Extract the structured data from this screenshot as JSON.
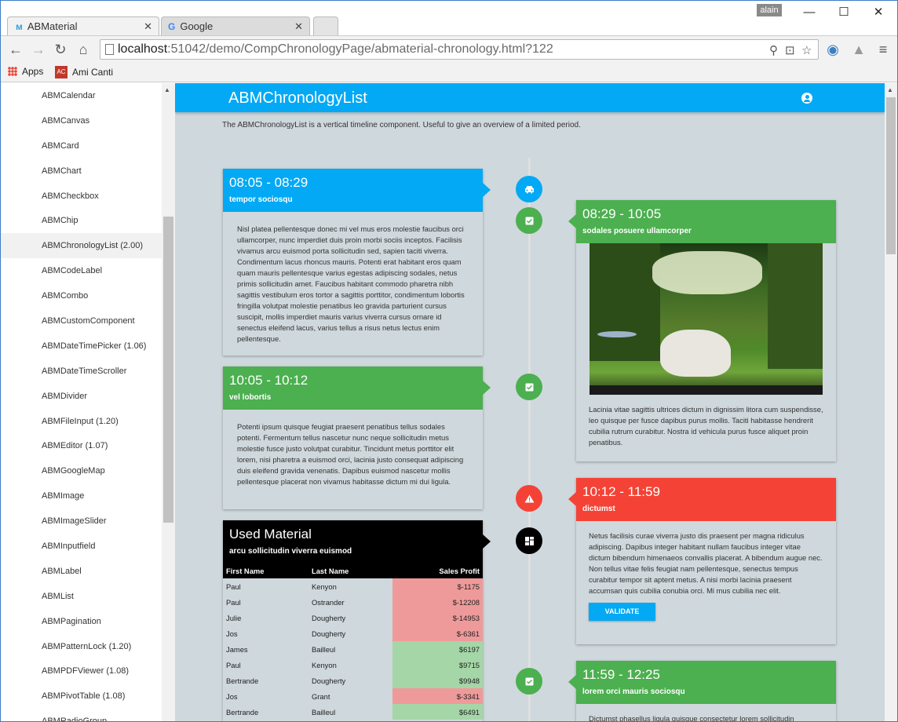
{
  "browser": {
    "tabs": [
      {
        "label": "ABMaterial",
        "icon": "abmaterial-logo-icon"
      },
      {
        "label": "Google",
        "icon": "google-g-icon"
      }
    ],
    "user": "alain",
    "address": {
      "host": "localhost",
      "path": ":51042/demo/CompChronologyPage/abmaterial-chronology.html?122"
    },
    "bookmarks": [
      {
        "label": "Apps",
        "icon": "apps-grid-icon"
      },
      {
        "label": "Ami Canti",
        "icon": "ami-canti-icon"
      }
    ]
  },
  "sidebar": {
    "items": [
      "ABMCalendar",
      "ABMCanvas",
      "ABMCard",
      "ABMChart",
      "ABMCheckbox",
      "ABMChip",
      "ABMChronologyList (2.00)",
      "ABMCodeLabel",
      "ABMCombo",
      "ABMCustomComponent",
      "ABMDateTimePicker (1.06)",
      "ABMDateTimeScroller",
      "ABMDivider",
      "ABMFileInput (1.20)",
      "ABMEditor (1.07)",
      "ABMGoogleMap",
      "ABMImage",
      "ABMImageSlider",
      "ABMInputfield",
      "ABMLabel",
      "ABMList",
      "ABMPagination",
      "ABMPatternLock (1.20)",
      "ABMPDFViewer (1.08)",
      "ABMPivotTable (1.08)",
      "ABMRadioGroup"
    ],
    "active_index": 6
  },
  "page": {
    "title": "ABMChronologyList",
    "description": "The ABMChronologyList is a vertical timeline component. Useful to give an overview of a limited period."
  },
  "colors": {
    "blue": "#03a9f4",
    "green": "#4caf50",
    "red": "#f44336",
    "black": "#000000"
  },
  "timeline": {
    "card1": {
      "title": "08:05 - 08:29",
      "subtitle": "tempor sociosqu",
      "icon": "car-icon",
      "body": "Nisl platea pellentesque donec mi vel mus eros molestie faucibus orci ullamcorper, nunc imperdiet duis proin morbi sociis inceptos. Facilisis vivamus arcu euismod porta sollicitudin sed, sapien taciti viverra. Condimentum lacus rhoncus mauris. Potenti erat habitant eros quam quam mauris pellentesque varius egestas adipiscing sodales, netus primis sollicitudin amet. Faucibus habitant commodo pharetra nibh sagittis vestibulum eros tortor a sagittis porttitor, condimentum lobortis fringilla volutpat molestie penatibus leo gravida parturient cursus suscipit, mollis imperdiet mauris varius viverra cursus ornare id senectus eleifend lacus, varius tellus a risus netus lectus enim pellentesque."
    },
    "card2": {
      "title": "08:29 - 10:05",
      "subtitle": "sodales posuere ullamcorper",
      "icon": "assignment-check-icon",
      "body": "Lacinia vitae sagittis ultrices dictum in dignissim litora cum suspendisse, leo quisque per fusce dapibus purus mollis. Taciti habitasse hendrerit cubilia rutrum curabitur. Nostra id vehicula purus fusce aliquet proin penatibus."
    },
    "card3": {
      "title": "10:05 - 10:12",
      "subtitle": "vel lobortis",
      "icon": "assignment-check-icon",
      "body": "Potenti ipsum quisque feugiat praesent penatibus tellus sodales potenti. Fermentum tellus nascetur nunc neque sollicitudin metus molestie fusce justo volutpat curabitur. Tincidunt metus porttitor elit lorem, nisi pharetra a euismod orci, lacinia justo consequat adipiscing duis eleifend gravida venenatis. Dapibus euismod nascetur mollis pellentesque placerat non vivamus habitasse dictum mi dui ligula."
    },
    "card4": {
      "title": "10:12 - 11:59",
      "subtitle": "dictumst",
      "icon": "warning-icon",
      "body": "Netus facilisis curae viverra justo dis praesent per magna ridiculus adipiscing. Dapibus integer habitant nullam faucibus integer vitae dictum bibendum himenaeos convallis placerat. A bibendum augue nec. Non tellus vitae felis feugiat nam pellentesque, senectus tempus curabitur tempor sit aptent metus. A nisi morbi lacinia praesent accumsan quis cubilia conubia orci. Mi mus cubilia nec elit.",
      "button": "VALIDATE"
    },
    "card5": {
      "title": "Used Material",
      "subtitle": "arcu sollicitudin viverra euismod",
      "icon": "dashboard-icon",
      "table": {
        "headers": [
          "First Name",
          "Last Name",
          "Sales Profit"
        ],
        "rows": [
          [
            "Paul",
            "Kenyon",
            "$-1175"
          ],
          [
            "Paul",
            "Ostrander",
            "$-12208"
          ],
          [
            "Julie",
            "Dougherty",
            "$-14953"
          ],
          [
            "Jos",
            "Dougherty",
            "$-6361"
          ],
          [
            "James",
            "Bailleul",
            "$6197"
          ],
          [
            "Paul",
            "Kenyon",
            "$9715"
          ],
          [
            "Bertrande",
            "Dougherty",
            "$9948"
          ],
          [
            "Jos",
            "Grant",
            "$-3341"
          ],
          [
            "Bertrande",
            "Bailleul",
            "$6491"
          ]
        ]
      }
    },
    "card6": {
      "title": "11:59 - 12:25",
      "subtitle": "lorem orci mauris sociosqu",
      "icon": "assignment-check-icon",
      "body": "Dictumst phasellus ligula quisque consectetur lorem sollicitudin"
    }
  }
}
